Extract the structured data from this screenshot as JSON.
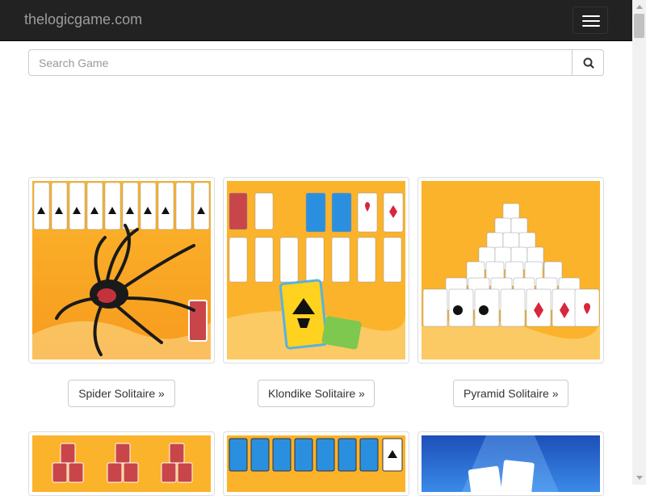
{
  "header": {
    "brand": "thelogicgame.com",
    "menu_icon": "hamburger-icon"
  },
  "search": {
    "placeholder": "Search Game",
    "value": "",
    "button_icon": "search-icon"
  },
  "games": [
    {
      "label": "Spider Solitaire »"
    },
    {
      "label": "Klondike Solitaire »"
    },
    {
      "label": "Pyramid Solitaire »"
    }
  ],
  "colors": {
    "navbar": "#222222",
    "brand": "#9d9d9d",
    "thumb_bg": "#f7b42b",
    "accent_blue": "#2b8fe0"
  }
}
